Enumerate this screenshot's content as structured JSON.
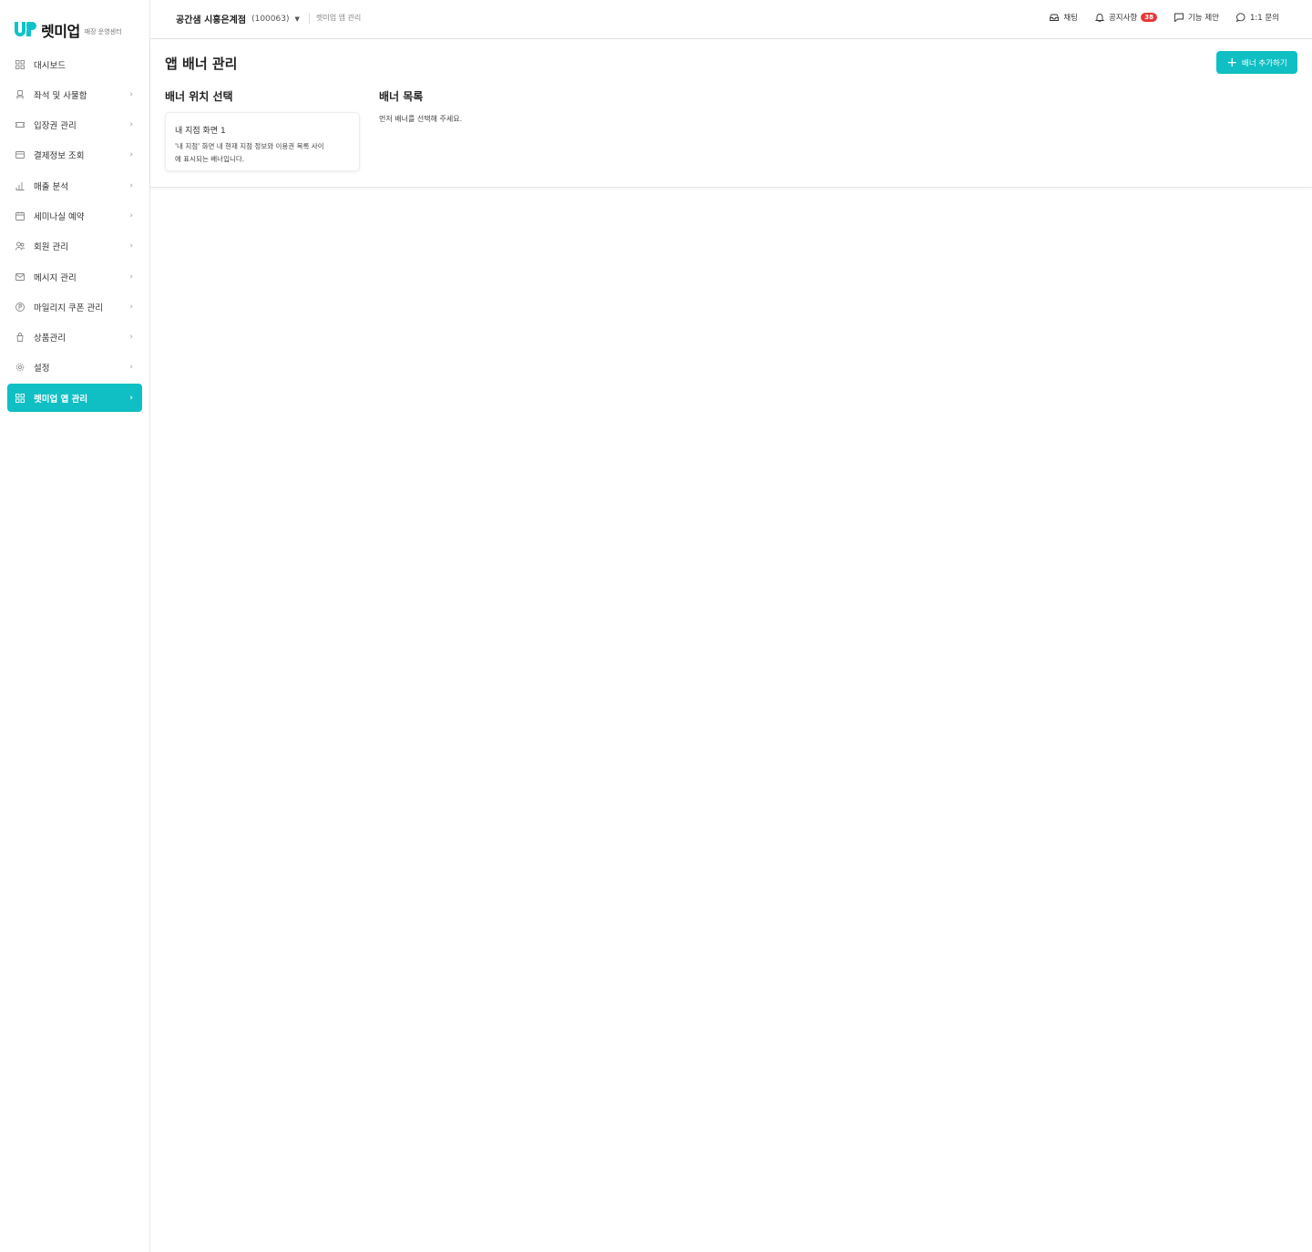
{
  "brand": {
    "name": "렛미업",
    "subtitle": "매장 운영센터"
  },
  "sidebar": {
    "items": [
      {
        "label": "대시보드",
        "icon": "grid-icon",
        "chevron": false
      },
      {
        "label": "좌석 및 사물함",
        "icon": "seat-icon",
        "chevron": true
      },
      {
        "label": "입장권 관리",
        "icon": "ticket-icon",
        "chevron": true
      },
      {
        "label": "결제정보 조회",
        "icon": "card-icon",
        "chevron": true
      },
      {
        "label": "매출 분석",
        "icon": "chart-icon",
        "chevron": true
      },
      {
        "label": "세미나실 예약",
        "icon": "calendar-icon",
        "chevron": true
      },
      {
        "label": "회원 관리",
        "icon": "users-icon",
        "chevron": true
      },
      {
        "label": "메시지 관리",
        "icon": "mail-icon",
        "chevron": true
      },
      {
        "label": "마일리지 쿠폰 관리",
        "icon": "point-icon",
        "chevron": true
      },
      {
        "label": "상품관리",
        "icon": "product-icon",
        "chevron": true
      },
      {
        "label": "설정",
        "icon": "gear-icon",
        "chevron": true
      },
      {
        "label": "렛미업 앱 관리",
        "icon": "grid-icon",
        "chevron": true,
        "active": true
      }
    ],
    "chevron_glyph": "›"
  },
  "topbar": {
    "store_name": "공간샘 시흥은계점",
    "store_code": "(100063)",
    "breadcrumb": "렛미업 앱 관리",
    "actions": {
      "chat": "채팅",
      "notice": "공지사항",
      "notice_count": "38",
      "suggest": "기능 제안",
      "inquiry": "1:1 문의"
    }
  },
  "main": {
    "title": "앱 배너 관리",
    "add_button": "배너 추가하기",
    "position_section_title": "배너 위치 선택",
    "list_section_title": "배너 목록",
    "position_card": {
      "title": "내 지점 화면 1",
      "desc_line1": "'내 지점' 화면 내 현재 지점 정보와 이용권 목록 사이",
      "desc_line2": "에 표시되는 배너입니다."
    },
    "empty_message": "먼저 배너를 선택해 주세요."
  },
  "colors": {
    "accent": "#0fbfc3",
    "badge": "#e6373a"
  }
}
